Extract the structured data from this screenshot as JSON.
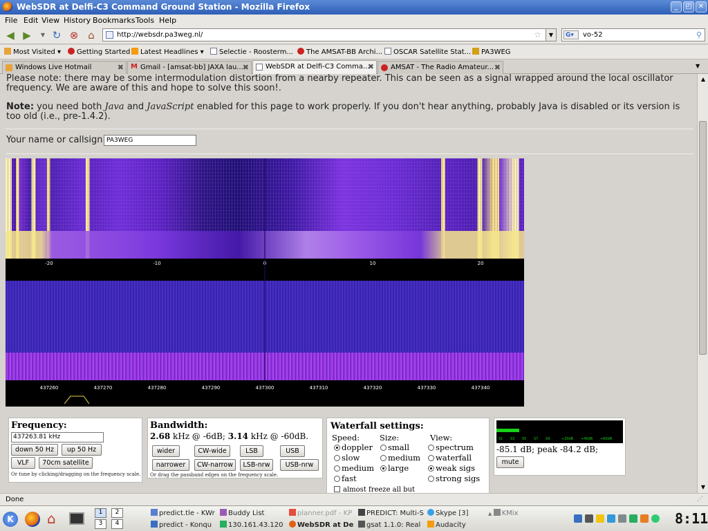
{
  "window": {
    "title": "WebSDR at Delfi-C3 Command Ground Station - Mozilla Firefox",
    "btn_min": "_",
    "btn_max": "◰",
    "btn_close": "✕"
  },
  "menu": [
    "File",
    "Edit",
    "View",
    "History",
    "Bookmarks",
    "Tools",
    "Help"
  ],
  "nav": {
    "url": "http://websdr.pa3weg.nl/",
    "search_value": "vo-52",
    "search_engine": "G▾"
  },
  "bookmarks": [
    "Most Visited ▾",
    "Getting Started",
    "Latest Headlines ▾",
    "Selectie - Roosterm...",
    "The AMSAT-BB Archi...",
    "OSCAR Satellite Stat...",
    "PA3WEG"
  ],
  "tabs": [
    "Windows Live Hotmail",
    "Gmail - [amsat-bb] JAXA lau...",
    "WebSDR at Delfi-C3 Comma...",
    "AMSAT - The Radio Amateur..."
  ],
  "page": {
    "notice": "Please note: there may be some intermodulation distortion from a nearby repeater. This can be seen as a signal wrapped around the local oscillator frequency. We are aware of this and hope to solve this soon!.",
    "note_label": "Note:",
    "note_pre": " you need both ",
    "java": "Java",
    "and": " and ",
    "javascript": "JavaScript",
    "note_post": " enabled for this page to work properly. If you don't hear anything, probably Java is disabled or its version is too old (i.e., pre-1.4.2).",
    "callsign_label": "Your name or callsign:",
    "callsign_value": "PA3WEG"
  },
  "waterfall": {
    "offset_scale_khz": [
      "-20",
      "-10",
      "0",
      "10",
      "20"
    ],
    "freq_scale_khz": [
      "437260",
      "437270",
      "437280",
      "437290",
      "437300",
      "437310",
      "437320",
      "437330",
      "437340"
    ]
  },
  "frequency": {
    "title": "Frequency:",
    "value": "437263.81 kHz",
    "down": "down 50 Hz",
    "up": "up 50 Hz",
    "vlf": "VLF",
    "sat": "70cm satellite",
    "hint": "Or tune by clicking/dragging on the frequency scale."
  },
  "bandwidth": {
    "title": "Bandwidth:",
    "v1": "2.68",
    "t1": " kHz @ -6dB; ",
    "v2": "3.14",
    "t2": " kHz @ -60dB.",
    "buttons": [
      "wider",
      "CW-wide",
      "LSB",
      "USB",
      "narrower",
      "CW-narrow",
      "LSB-nrw",
      "USB-nrw"
    ],
    "hint": "Or drag the passband edges on the frequency scale."
  },
  "waterfall_settings": {
    "title": "Waterfall settings:",
    "speed_label": "Speed:",
    "size_label": "Size:",
    "view_label": "View:",
    "speed": [
      "doppler",
      "slow",
      "medium",
      "fast"
    ],
    "size": [
      "small",
      "medium",
      "large"
    ],
    "view": [
      "spectrum",
      "waterfall",
      "weak sigs",
      "strong sigs"
    ],
    "freeze": "almost freeze all but"
  },
  "smeter": {
    "scale": [
      "S1",
      "S3",
      "S5",
      "S7",
      "S9",
      "+20dB",
      "+40dB",
      "+60dB"
    ],
    "reading": "-85.1 dB; peak -84.2 dB;",
    "level": 0.18,
    "mute": "mute"
  },
  "status": "Done",
  "taskbar": {
    "windows_row1": [
      "predict.tle - KWr",
      "Buddy List",
      "planner.pdf - KP",
      "PREDICT: Multi-S",
      "Skype [3]",
      "KMix"
    ],
    "windows_row2": [
      "predict - Konqu",
      "130.161.43.120",
      "WebSDR at De",
      "gsat 1.1.0: Real",
      "Audacity"
    ],
    "pager": [
      "1",
      "2",
      "3",
      "4"
    ],
    "clock": "8:11"
  },
  "colors": {
    "accent": "#2f5fb7",
    "smeter_bar": "#17d017"
  }
}
